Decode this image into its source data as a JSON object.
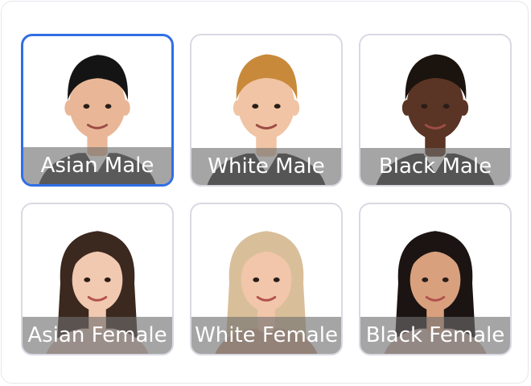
{
  "cards": [
    {
      "label": "Asian Male",
      "selected": true,
      "icon": "asian-male-portrait-icon",
      "colors": {
        "hair": "#141414",
        "skin": "#e9b797",
        "shirt": "#3a3a3a",
        "collar": "#ffffff"
      }
    },
    {
      "label": "White Male",
      "selected": false,
      "icon": "white-male-portrait-icon",
      "colors": {
        "hair": "#c88a3a",
        "skin": "#f0c4a4",
        "shirt": "#2f2f2f",
        "collar": "#ffffff"
      }
    },
    {
      "label": "Black Male",
      "selected": false,
      "icon": "black-male-portrait-icon",
      "colors": {
        "hair": "#1b130e",
        "skin": "#5a3424",
        "shirt": "#2f2f2f",
        "collar": "#ffffff"
      }
    },
    {
      "label": "Asian Female",
      "selected": false,
      "icon": "asian-female-portrait-icon",
      "colors": {
        "hair": "#3b281e",
        "skin": "#f1c8b0",
        "shirt": "#e0c3b6",
        "collar": "#e0c3b6"
      }
    },
    {
      "label": "White Female",
      "selected": false,
      "icon": "white-female-portrait-icon",
      "colors": {
        "hair": "#d8bf9a",
        "skin": "#f2c6aa",
        "shirt": "#cfa38a",
        "collar": "#cfa38a"
      }
    },
    {
      "label": "Black Female",
      "selected": false,
      "icon": "black-female-portrait-icon",
      "colors": {
        "hair": "#1b1412",
        "skin": "#d9a07e",
        "shirt": "#cfb3a8",
        "collar": "#cfb3a8"
      }
    }
  ],
  "accent": "#2f6fe4",
  "card_border": "#d9d9e3"
}
